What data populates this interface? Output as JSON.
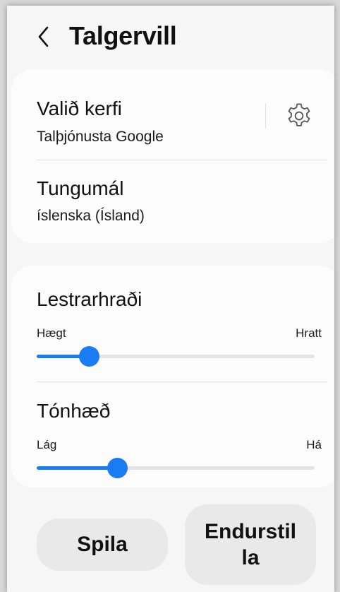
{
  "header": {
    "title": "Talgervill",
    "back_icon": "chevron-left-icon"
  },
  "engine": {
    "title": "Valið kerfi",
    "value": "Talþjónusta Google",
    "settings_icon": "gear-icon"
  },
  "language": {
    "title": "Tungumál",
    "value": "íslenska (Ísland)"
  },
  "speech_rate": {
    "title": "Lestrarhraði",
    "min_label": "Hægt",
    "max_label": "Hratt",
    "value": 0.19
  },
  "pitch": {
    "title": "Tónhæð",
    "min_label": "Lág",
    "max_label": "Há",
    "value": 0.29
  },
  "buttons": {
    "play": "Spila",
    "reset": "Endurstilla"
  },
  "colors": {
    "accent": "#1a7cf2",
    "background": "#f6f6f6",
    "card": "#fcfcfc",
    "button": "#e9e9e9"
  }
}
